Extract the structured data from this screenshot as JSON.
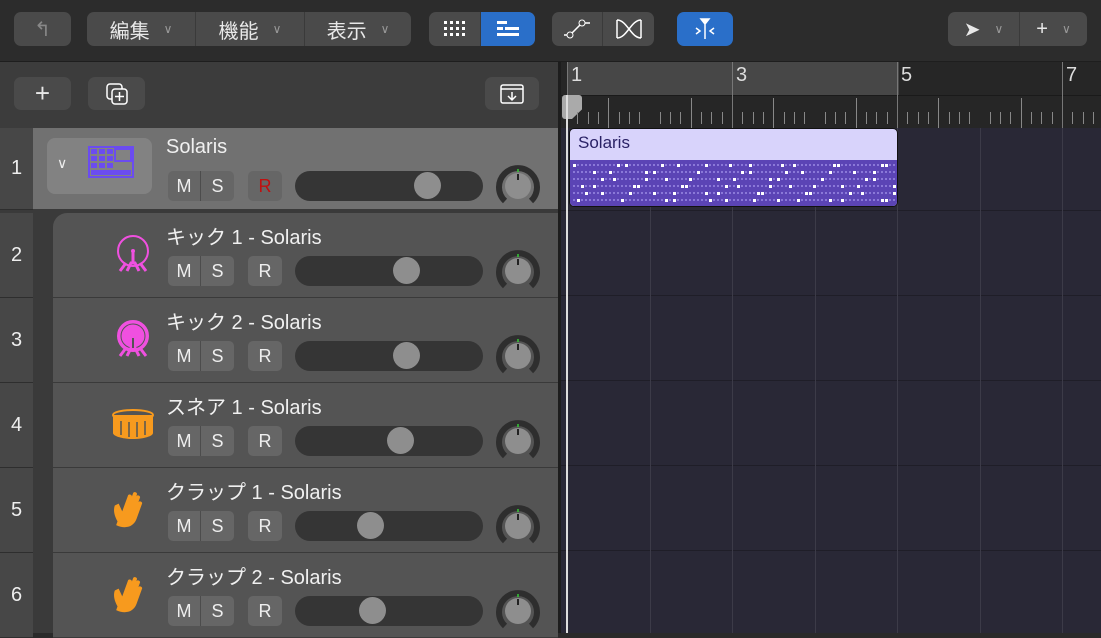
{
  "toolbar": {
    "back_icon": "back-arrow-icon",
    "menus": [
      {
        "label": "編集"
      },
      {
        "label": "機能"
      },
      {
        "label": "表示"
      }
    ],
    "view_grid_icon": "grid-view-icon",
    "view_list_icon": "list-view-icon",
    "automation_icon": "automation-icon",
    "crossfade_icon": "crossfade-icon",
    "snap_icon": "snap-align-icon",
    "pointer_tool_icon": "pointer-icon",
    "secondary_tool_icon": "crosshair-icon"
  },
  "subbar": {
    "add_icon": "plus-icon",
    "duplicate_icon": "duplicate-track-icon",
    "download_icon": "download-icon"
  },
  "ruler": {
    "bars": [
      "1",
      "3",
      "5",
      "7"
    ]
  },
  "region": {
    "name": "Solaris"
  },
  "tracks": [
    {
      "number": "1",
      "name": "Solaris",
      "mute": "M",
      "solo": "S",
      "record": "R",
      "volume": 0.7,
      "icon": "drum-machine-icon",
      "selected": true
    },
    {
      "number": "2",
      "name": "キック 1 - Solaris",
      "mute": "M",
      "solo": "S",
      "record": "R",
      "volume": 0.59,
      "icon": "kick-drum-icon"
    },
    {
      "number": "3",
      "name": "キック 2 - Solaris",
      "mute": "M",
      "solo": "S",
      "record": "R",
      "volume": 0.59,
      "icon": "kick-drum-filled-icon"
    },
    {
      "number": "4",
      "name": "スネア 1 - Solaris",
      "mute": "M",
      "solo": "S",
      "record": "R",
      "volume": 0.56,
      "icon": "snare-drum-icon"
    },
    {
      "number": "5",
      "name": "クラップ 1 - Solaris",
      "mute": "M",
      "solo": "S",
      "record": "R",
      "volume": 0.4,
      "icon": "hand-clap-icon"
    },
    {
      "number": "6",
      "name": "クラップ 2 - Solaris",
      "mute": "M",
      "solo": "S",
      "record": "R",
      "volume": 0.41,
      "icon": "hand-clap-icon"
    }
  ],
  "colors": {
    "accent": "#2a6fc9",
    "region_header": "#d8d3fb",
    "region_body": "#5b44b5",
    "kick": "#f050e0",
    "snare": "#f79a1e"
  }
}
